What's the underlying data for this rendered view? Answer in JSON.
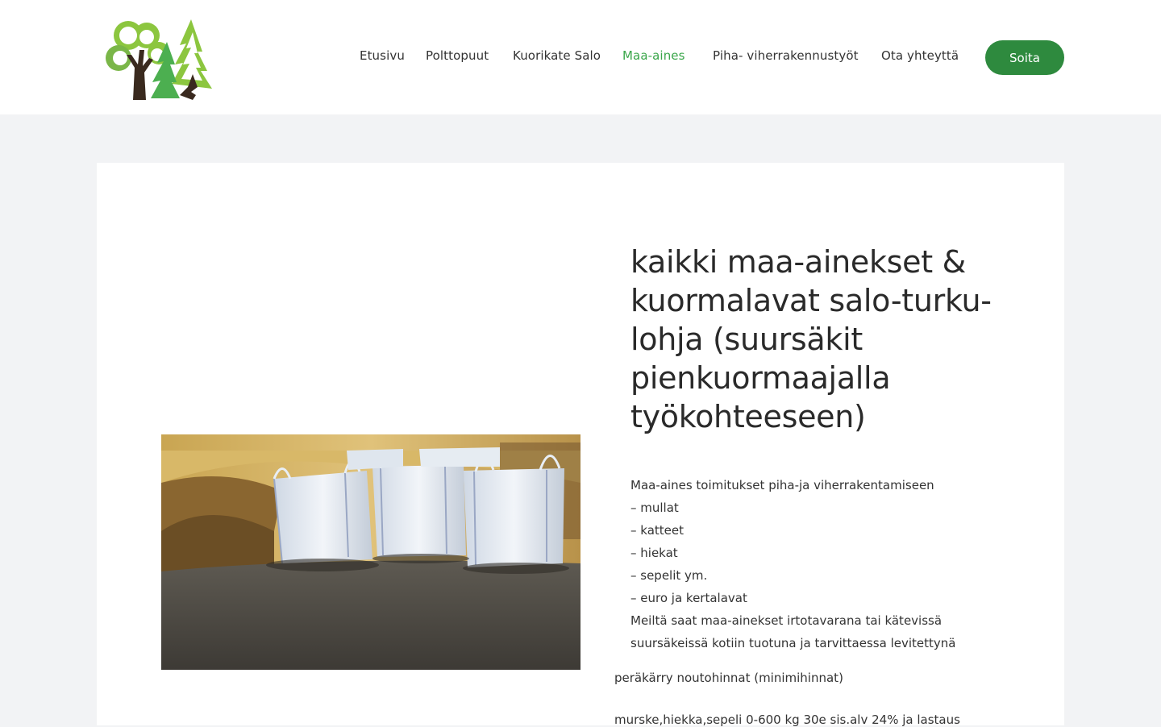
{
  "nav": {
    "items": [
      {
        "label": "Etusivu"
      },
      {
        "label": "Polttopuut"
      },
      {
        "label": "Kuorikate Salo"
      },
      {
        "label": "Maa-aines"
      },
      {
        "label": "Piha- viherrakennustyöt"
      },
      {
        "label": "Ota yhteyttä"
      }
    ],
    "active": "Maa-aines",
    "call_label": "Soita"
  },
  "colors": {
    "accent_green": "#3aa64a",
    "button_green": "#2e8a3e",
    "page_bg": "#f2f3f5"
  },
  "main": {
    "title": "kaikki maa-ainekset & kuormalavat salo-turku-lohja (suursäkit pienkuormaajalla työkohteeseen)",
    "intro_lines": [
      "Maa-aines toimitukset piha-ja viherrakentamiseen",
      "– mullat",
      "– katteet",
      "– hiekat",
      "– sepelit ym.",
      "– euro ja kertalavat",
      "Meiltä saat maa-ainekset irtotavarana tai kätevissä suursäkeissä kotiin tuotuna ja tarvittaessa levitettynä"
    ],
    "pickup_heading": "peräkärry noutohinnat (minimihinnat)",
    "price_line": "murske,hiekka,sepeli 0-600 kg 30e sis.alv 24% ja lastaus"
  }
}
